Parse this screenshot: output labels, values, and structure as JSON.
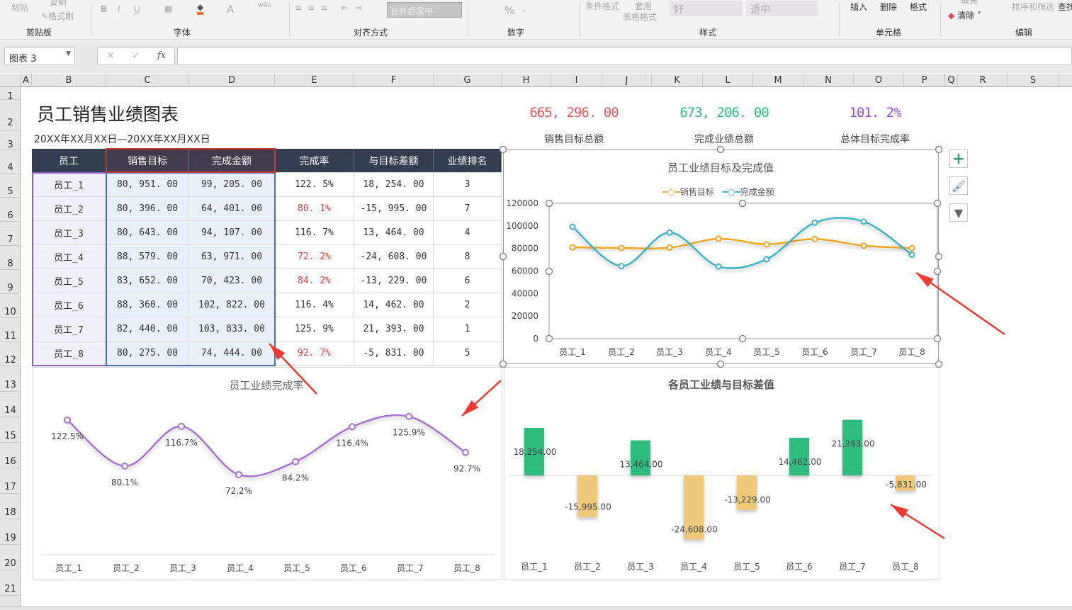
{
  "ribbon": {
    "clipboard": {
      "paste": "粘贴",
      "copy": "复制",
      "format_painter": "格式刷",
      "label": "剪贴板"
    },
    "font": {
      "bold": "B",
      "italic": "I",
      "underline": "U",
      "font_color": "A",
      "phonetic": "wén",
      "label": "字体"
    },
    "alignment": {
      "merge_center": "合并后居中",
      "label": "对齐方式"
    },
    "number": {
      "percent": "%",
      "comma": ",",
      "label": "数字"
    },
    "styles": {
      "conditional": "条件格式",
      "table_format_1": "套用",
      "table_format_2": "表格格式",
      "good": "好",
      "neutral": "适中",
      "label": "样式"
    },
    "cells": {
      "insert": "插入",
      "delete": "删除",
      "format": "格式",
      "label": "单元格"
    },
    "editing": {
      "fill": "填充",
      "clear": "清除",
      "sort_filter": "排序和筛选",
      "find": "查找",
      "label": "编辑"
    }
  },
  "formula_bar": {
    "name_box": "图表 3",
    "cancel": "✕",
    "enter": "✓",
    "fx": "fx",
    "formula": ""
  },
  "columns": [
    "A",
    "B",
    "C",
    "D",
    "E",
    "F",
    "G",
    "H",
    "I",
    "J",
    "K",
    "L",
    "M",
    "N",
    "O",
    "P",
    "Q",
    "R",
    "S"
  ],
  "rows": [
    "1",
    "2",
    "3",
    "4",
    "5",
    "6",
    "7",
    "8",
    "9",
    "10",
    "11",
    "12",
    "13",
    "14",
    "15",
    "16",
    "17",
    "18",
    "19",
    "20",
    "21"
  ],
  "sheet": {
    "title": "员工销售业绩图表",
    "date_range": "20XX年XX月XX日—20XX年XX月XX日",
    "kpis": [
      {
        "value": "665, 296. 00",
        "label": "销售目标总额",
        "color": "#f0545a"
      },
      {
        "value": "673, 206. 00",
        "label": "完成业绩总额",
        "color": "#2fc082"
      },
      {
        "value": "101. 2%",
        "label": "总体目标完成率",
        "color": "#9b4fe0"
      }
    ],
    "table": {
      "headers": [
        "员工",
        "销售目标",
        "完成金额",
        "完成率",
        "与目标差额",
        "业绩排名"
      ],
      "rows": [
        [
          "员工_1",
          "80, 951. 00",
          "99, 205. 00",
          "122. 5%",
          "18, 254. 00",
          "3"
        ],
        [
          "员工_2",
          "80, 396. 00",
          "64, 401. 00",
          "80. 1%",
          "-15, 995. 00",
          "7"
        ],
        [
          "员工_3",
          "80, 643. 00",
          "94, 107. 00",
          "116. 7%",
          "13, 464. 00",
          "4"
        ],
        [
          "员工_4",
          "88, 579. 00",
          "63, 971. 00",
          "72. 2%",
          "-24, 608. 00",
          "8"
        ],
        [
          "员工_5",
          "83, 652. 00",
          "70, 423. 00",
          "84. 2%",
          "-13, 229. 00",
          "6"
        ],
        [
          "员工_6",
          "88, 360. 00",
          "102, 822. 00",
          "116. 4%",
          "14, 462. 00",
          "2"
        ],
        [
          "员工_7",
          "82, 440. 00",
          "103, 833. 00",
          "125. 9%",
          "21, 393. 00",
          "1"
        ],
        [
          "员工_8",
          "80, 275. 00",
          "74, 444. 00",
          "92. 7%",
          "-5, 831. 00",
          "5"
        ]
      ],
      "below_target_color": "#e53935"
    }
  },
  "chart_data": [
    {
      "type": "line",
      "title": "员工业绩目标及完成值",
      "categories": [
        "员工_1",
        "员工_2",
        "员工_3",
        "员工_4",
        "员工_5",
        "员工_6",
        "员工_7",
        "员工_8"
      ],
      "series": [
        {
          "name": "销售目标",
          "color": "#f5a623",
          "values": [
            80951,
            80396,
            80643,
            88579,
            83652,
            88360,
            82440,
            80275
          ]
        },
        {
          "name": "完成金额",
          "color": "#3bb3c9",
          "values": [
            99205,
            64401,
            94107,
            63971,
            70423,
            102822,
            103833,
            74444
          ]
        }
      ],
      "ylim": [
        0,
        120000
      ],
      "yticks": [
        "0",
        "20000",
        "40000",
        "60000",
        "80000",
        "100000",
        "120000"
      ],
      "legend": "top"
    },
    {
      "type": "line",
      "title": "员工业绩完成率",
      "categories": [
        "员工_1",
        "员工_2",
        "员工_3",
        "员工_4",
        "员工_5",
        "员工_6",
        "员工_7",
        "员工_8"
      ],
      "series": [
        {
          "name": "完成率",
          "color": "#a971d8",
          "values": [
            122.5,
            80.1,
            116.7,
            72.2,
            84.2,
            116.4,
            125.9,
            92.7
          ]
        }
      ],
      "labels": [
        "122.5%",
        "80.1%",
        "116.7%",
        "72.2%",
        "84.2%",
        "116.4%",
        "125.9%",
        "92.7%"
      ]
    },
    {
      "type": "bar",
      "title": "各员工业绩与目标差值",
      "categories": [
        "员工_1",
        "员工_2",
        "员工_3",
        "员工_4",
        "员工_5",
        "员工_6",
        "员工_7",
        "员工_8"
      ],
      "values": [
        18254,
        -15995,
        13464,
        -24608,
        -13229,
        14462,
        21393,
        -5831
      ],
      "labels": [
        "18,254.00",
        "-15,995.00",
        "13,464.00",
        "-24,608.00",
        "-13,229.00",
        "14,462.00",
        "21,393.00",
        "-5,831.00"
      ],
      "positive_color": "#2dbd7e",
      "negative_color": "#f0c87a"
    }
  ],
  "chart_tools": {
    "add": "+",
    "style": "brush",
    "filter": "filter"
  }
}
